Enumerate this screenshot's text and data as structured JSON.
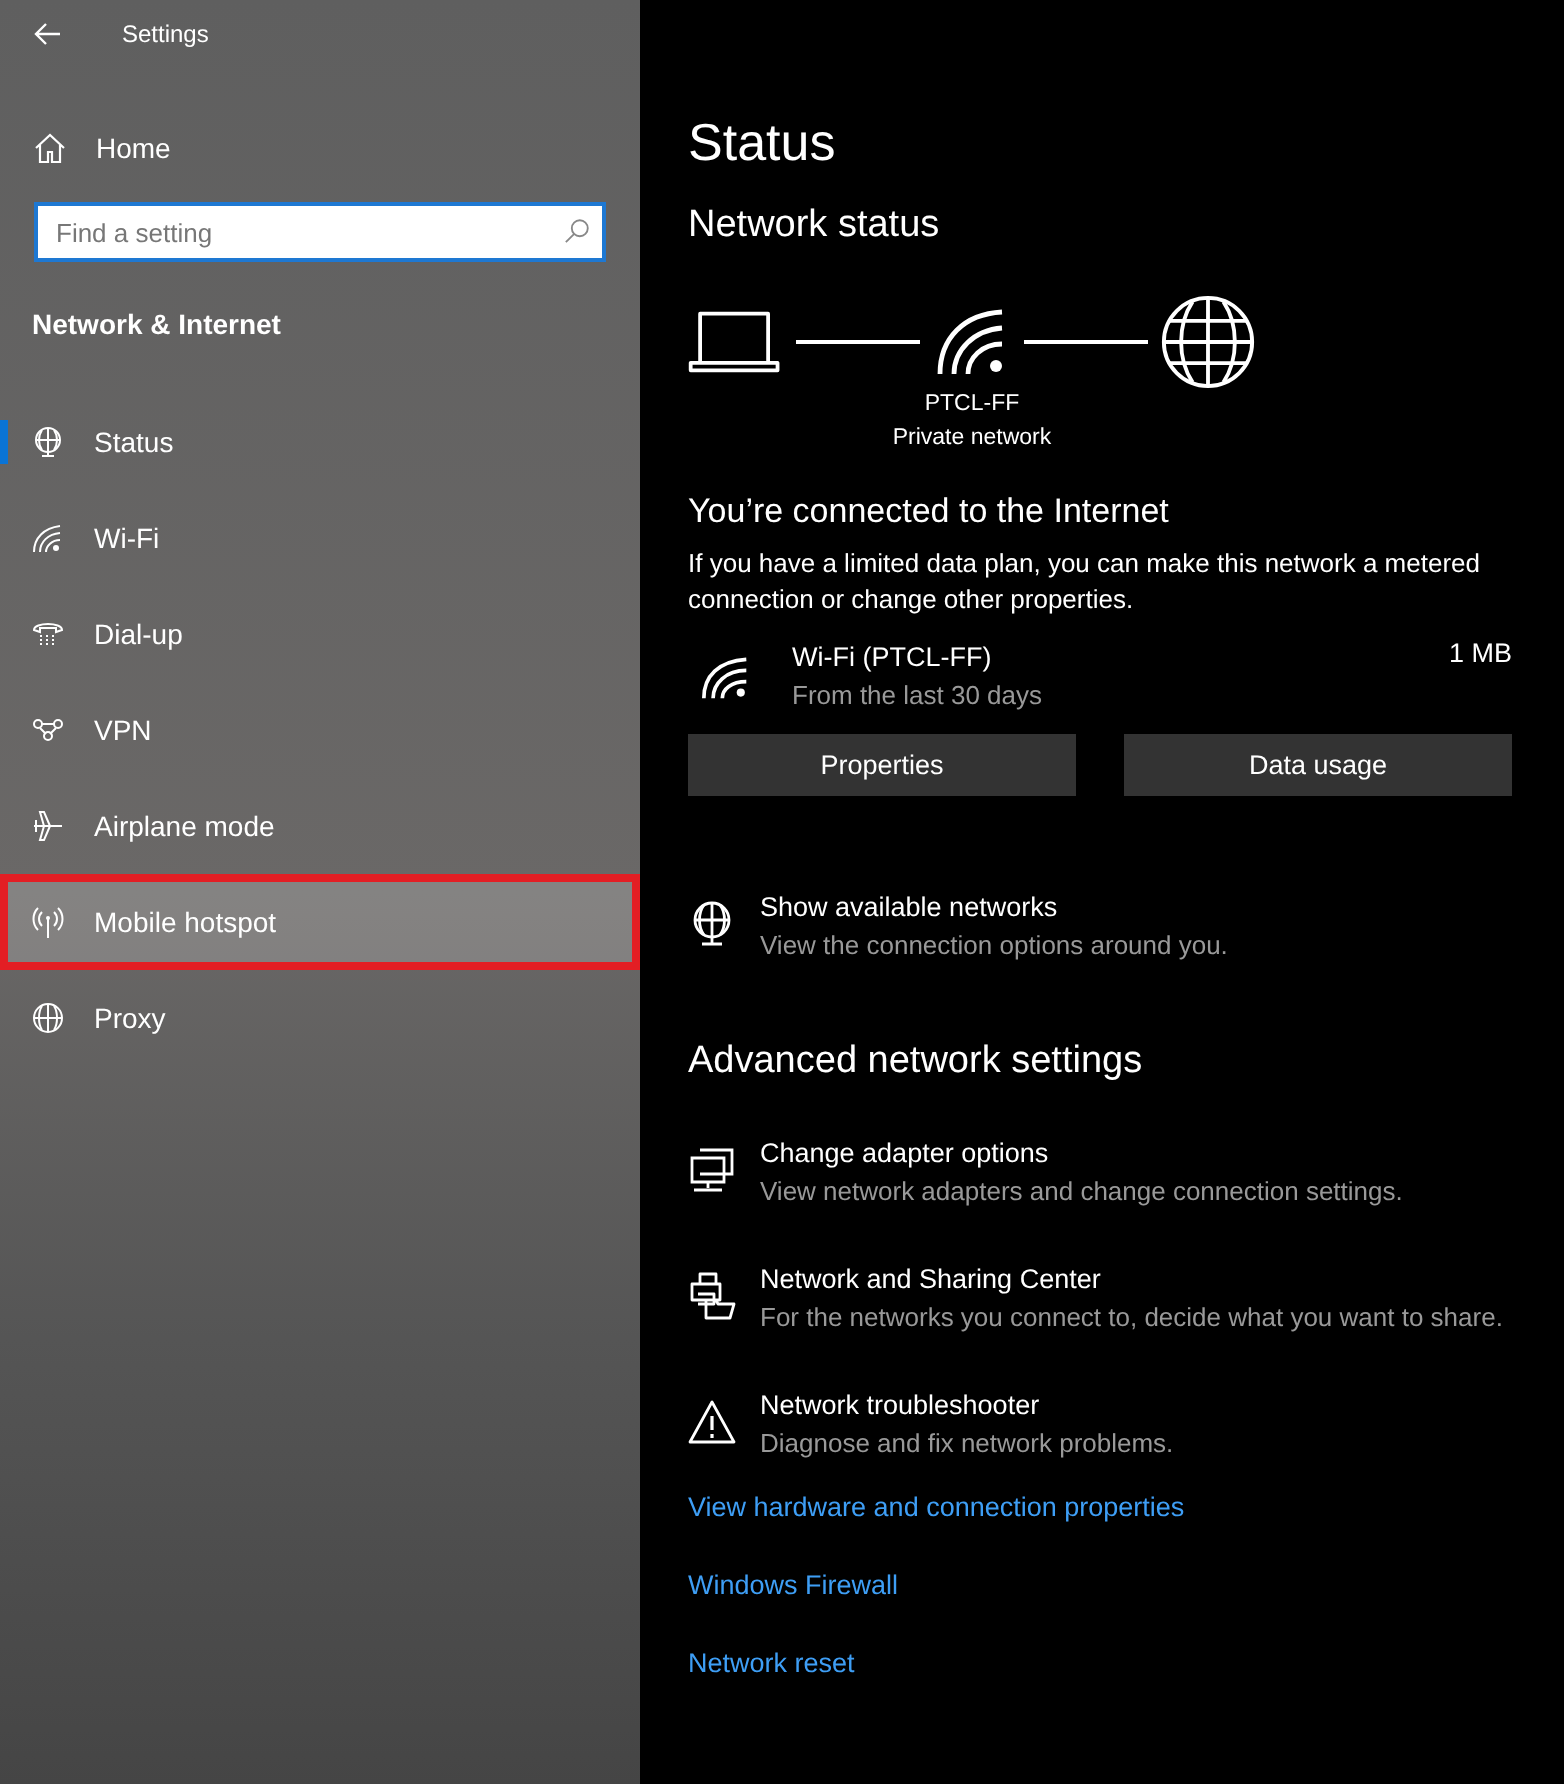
{
  "window": {
    "title": "Settings"
  },
  "sidebar": {
    "home": "Home",
    "search": {
      "placeholder": "Find a setting"
    },
    "section": "Network & Internet",
    "items": [
      {
        "label": "Status",
        "selected": true,
        "highlighted": false
      },
      {
        "label": "Wi-Fi",
        "selected": false,
        "highlighted": false
      },
      {
        "label": "Dial-up",
        "selected": false,
        "highlighted": false
      },
      {
        "label": "VPN",
        "selected": false,
        "highlighted": false
      },
      {
        "label": "Airplane mode",
        "selected": false,
        "highlighted": false
      },
      {
        "label": "Mobile hotspot",
        "selected": false,
        "highlighted": true
      },
      {
        "label": "Proxy",
        "selected": false,
        "highlighted": false
      }
    ]
  },
  "main": {
    "title": "Status",
    "network_status": {
      "heading": "Network status",
      "network_name": "PTCL-FF",
      "network_type": "Private network"
    },
    "connection": {
      "heading": "You’re connected to the Internet",
      "text": "If you have a limited data plan, you can make this network a metered connection or change other properties.",
      "network": {
        "name": "Wi-Fi (PTCL-FF)",
        "period": "From the last 30 days",
        "usage": "1 MB"
      },
      "buttons": [
        "Properties",
        "Data usage"
      ]
    },
    "show_networks": {
      "title": "Show available networks",
      "subtitle": "View the connection options around you."
    },
    "advanced": {
      "heading": "Advanced network settings",
      "items": [
        {
          "title": "Change adapter options",
          "subtitle": "View network adapters and change connection settings."
        },
        {
          "title": "Network and Sharing Center",
          "subtitle": "For the networks you connect to, decide what you want to share."
        },
        {
          "title": "Network troubleshooter",
          "subtitle": "Diagnose and fix network problems."
        }
      ],
      "links": [
        "View hardware and connection properties",
        "Windows Firewall",
        "Network reset"
      ]
    }
  }
}
